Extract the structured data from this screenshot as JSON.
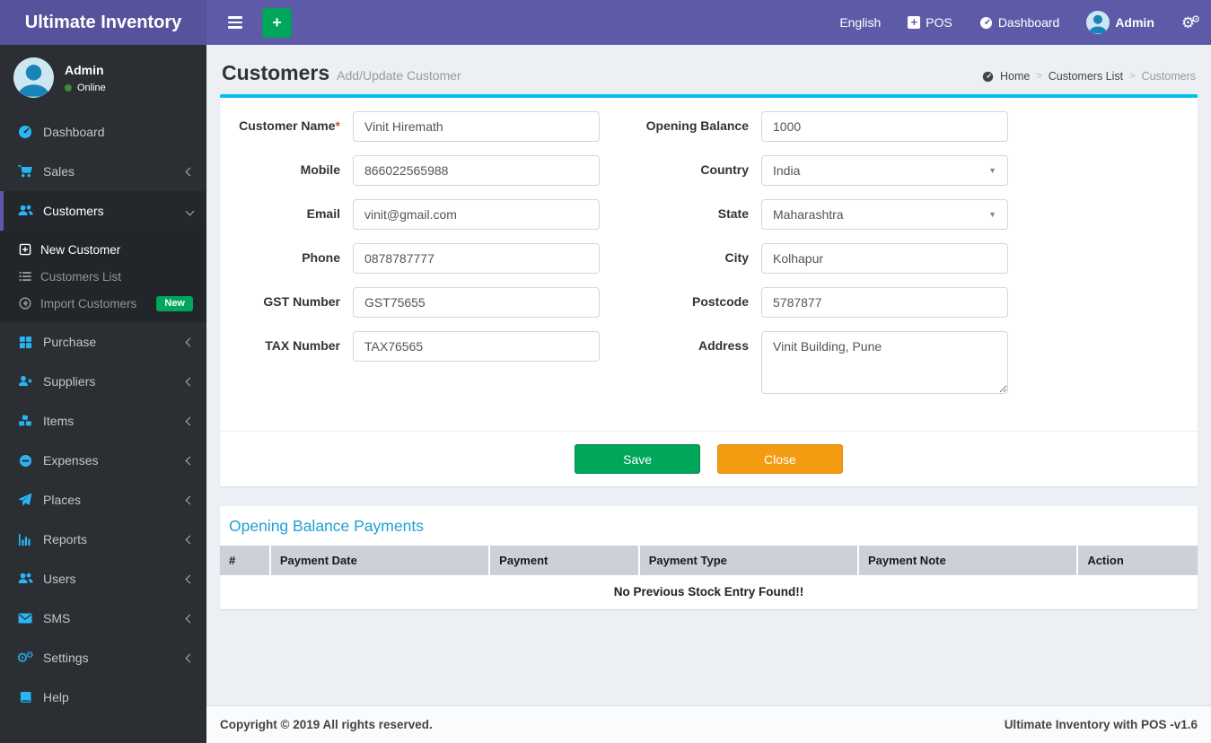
{
  "colors": {
    "navbar": "#5d5ba7",
    "sidebar": "#2b2e33",
    "icon_accent": "#29b6f6",
    "green": "#00a65a",
    "orange": "#f39c12",
    "box_top_bar": "#00c0ef",
    "section_title_blue": "#1e9fd6",
    "table_header": "#ccd0d8"
  },
  "icons": {
    "pos_plus": "+",
    "quick_add_plus": "+",
    "gear": "⚙",
    "gear_small": "⚙",
    "caret": "▼"
  },
  "navbar": {
    "brand": "Ultimate Inventory",
    "language": "English",
    "pos": "POS",
    "dashboard": "Dashboard",
    "user": "Admin"
  },
  "sidebar": {
    "user": {
      "name": "Admin",
      "status": "Online"
    },
    "items": [
      {
        "label": "Dashboard"
      },
      {
        "label": "Sales"
      },
      {
        "label": "Customers"
      },
      {
        "label": "Purchase"
      },
      {
        "label": "Suppliers"
      },
      {
        "label": "Items"
      },
      {
        "label": "Expenses"
      },
      {
        "label": "Places"
      },
      {
        "label": "Reports"
      },
      {
        "label": "Users"
      },
      {
        "label": "SMS"
      },
      {
        "label": "Settings"
      },
      {
        "label": "Help"
      }
    ],
    "customers_submenu": [
      {
        "label": "New Customer"
      },
      {
        "label": "Customers List"
      },
      {
        "label": "Import Customers",
        "badge": "New"
      }
    ]
  },
  "page": {
    "title": "Customers",
    "subtitle": "Add/Update Customer",
    "separator": ">",
    "breadcrumb": [
      "Home",
      "Customers List",
      "Customers"
    ]
  },
  "form": {
    "required_mark": "*",
    "customer_name": {
      "label": "Customer Name",
      "value": "Vinit Hiremath"
    },
    "mobile": {
      "label": "Mobile",
      "value": "866022565988"
    },
    "email": {
      "label": "Email",
      "value": "vinit@gmail.com"
    },
    "phone": {
      "label": "Phone",
      "value": "0878787777"
    },
    "gst": {
      "label": "GST Number",
      "value": "GST75655"
    },
    "tax": {
      "label": "TAX Number",
      "value": "TAX76565"
    },
    "opening_balance": {
      "label": "Opening Balance",
      "value": "1000"
    },
    "country": {
      "label": "Country",
      "value": "India"
    },
    "state": {
      "label": "State",
      "value": "Maharashtra"
    },
    "city": {
      "label": "City",
      "value": "Kolhapur"
    },
    "postcode": {
      "label": "Postcode",
      "value": "5787877"
    },
    "address": {
      "label": "Address",
      "value": "Vinit Building, Pune"
    },
    "save_label": "Save",
    "close_label": "Close"
  },
  "payments": {
    "title": "Opening Balance Payments",
    "columns": [
      "#",
      "Payment Date",
      "Payment",
      "Payment Type",
      "Payment Note",
      "Action"
    ],
    "empty_message": "No Previous Stock Entry Found!!"
  },
  "footer": {
    "left": "Copyright © 2019 All rights reserved.",
    "right": "Ultimate Inventory with POS -v1.6"
  }
}
